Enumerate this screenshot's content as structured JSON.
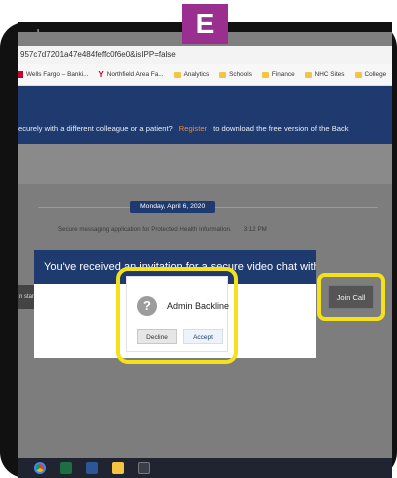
{
  "badge": "E",
  "browser": {
    "new_tab": "+",
    "url": "957c7d7201a47e484feffc0f6e0&isIPP=false",
    "bookmarks": [
      {
        "label": "Wells Fargo – Banki...",
        "icon": "wells-fargo-icon"
      },
      {
        "label": "Northfield Area Fa...",
        "icon": "ymca-icon"
      },
      {
        "label": "Analytics",
        "icon": "folder-icon"
      },
      {
        "label": "Schools",
        "icon": "folder-icon"
      },
      {
        "label": "Finance",
        "icon": "folder-icon"
      },
      {
        "label": "NHC Sites",
        "icon": "folder-icon"
      },
      {
        "label": "College",
        "icon": "folder-icon"
      }
    ]
  },
  "promo": {
    "text_before": "ecurely with a different colleague or a patient?",
    "register": "Register",
    "text_after": "to download the free version of the Back"
  },
  "chat": {
    "date": "Monday, April 6, 2020",
    "secure_note": "Secure messaging application for Protected Health Information.",
    "time": "3:12 PM",
    "left_snippet": "n star",
    "join_call": "Join Call"
  },
  "modal": {
    "header": "You've received an invitation for a secure video chat with:",
    "avatar": "?",
    "name": "Admin Backline",
    "decline": "Decline",
    "accept": "Accept"
  },
  "colors": {
    "header_blue": "#1e3a6f",
    "highlight_yellow": "#f4e11b",
    "badge_purple": "#9b2f8f",
    "register_orange": "#f08a3c"
  },
  "taskbar": [
    "chrome-icon",
    "excel-icon",
    "word-icon",
    "file-explorer-icon",
    "app-icon"
  ]
}
